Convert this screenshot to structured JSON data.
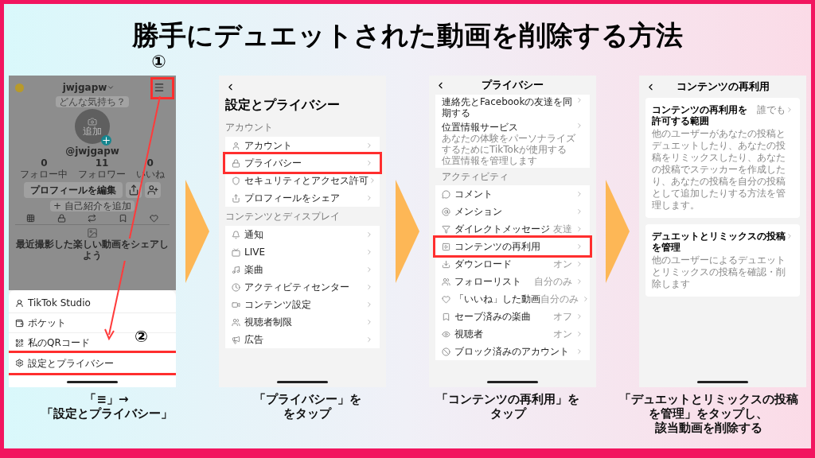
{
  "title": "勝手にデュエットされた動画を削除する方法",
  "screens": [
    {
      "kind": "profile",
      "username": "jwjgapw",
      "mood_bubble": "どんな気持ち？",
      "avatar_label": "追加",
      "handle": "@jwjgapw",
      "stats": [
        {
          "value": "0",
          "label": "フォロー中"
        },
        {
          "value": "11",
          "label": "フォロワー"
        },
        {
          "value": "0",
          "label": "いいね"
        }
      ],
      "edit_button": "プロフィールを編集",
      "bio_button": "+ 自己紹介を追加",
      "empty_message": "最近撮影した楽しい動画をシェアしよう",
      "menu": [
        {
          "label": "TikTok Studio",
          "highlighted": false
        },
        {
          "label": "ポケット",
          "highlighted": false
        },
        {
          "label": "私のQRコード",
          "highlighted": false
        },
        {
          "label": "設定とプライバシー",
          "highlighted": true
        }
      ],
      "markers": [
        "①",
        "②"
      ]
    },
    {
      "kind": "settings",
      "title": "設定とプライバシー",
      "sections": [
        {
          "heading": "アカウント",
          "items": [
            {
              "label": "アカウント",
              "highlighted": false
            },
            {
              "label": "プライバシー",
              "highlighted": true
            },
            {
              "label": "セキュリティとアクセス許可",
              "highlighted": false
            },
            {
              "label": "プロフィールをシェア",
              "highlighted": false
            }
          ]
        },
        {
          "heading": "コンテンツとディスプレイ",
          "items": [
            {
              "label": "通知",
              "highlighted": false
            },
            {
              "label": "LIVE",
              "highlighted": false
            },
            {
              "label": "楽曲",
              "highlighted": false
            },
            {
              "label": "アクティビティセンター",
              "highlighted": false
            },
            {
              "label": "コンテンツ設定",
              "highlighted": false
            },
            {
              "label": "視聴者制限",
              "highlighted": false
            },
            {
              "label": "広告",
              "highlighted": false
            }
          ]
        }
      ]
    },
    {
      "kind": "privacy",
      "title": "プライバシー",
      "top_items": [
        {
          "label": "連絡先とFacebookの友達を同期する"
        },
        {
          "label": "位置情報サービス",
          "description": "あなたの体験をパーソナライズするためにTikTokが使用する位置情報を管理します"
        }
      ],
      "sections": [
        {
          "heading": "アクティビティ",
          "items": [
            {
              "label": "コメント",
              "highlighted": false
            },
            {
              "label": "メンション",
              "highlighted": false
            },
            {
              "label": "ダイレクトメッセージ",
              "value": "友達",
              "highlighted": false
            },
            {
              "label": "コンテンツの再利用",
              "highlighted": true
            },
            {
              "label": "ダウンロード",
              "value": "オン",
              "highlighted": false
            },
            {
              "label": "フォローリスト",
              "value": "自分のみ",
              "highlighted": false
            },
            {
              "label": "「いいね」した動画",
              "value": "自分のみ",
              "highlighted": false
            },
            {
              "label": "セーブ済みの楽曲",
              "value": "オフ",
              "highlighted": false
            },
            {
              "label": "視聴者",
              "value": "オン",
              "highlighted": false
            },
            {
              "label": "ブロック済みのアカウント",
              "highlighted": false
            }
          ]
        }
      ]
    },
    {
      "kind": "reuse",
      "title": "コンテンツの再利用",
      "items": [
        {
          "label": "コンテンツの再利用を許可する範囲",
          "value": "誰でも",
          "description": "他のユーザーがあなたの投稿とデュエットしたり、あなたの投稿をリミックスしたり、あなたの投稿でステッカーを作成したり、あなたの投稿を自分の投稿として追加したりする方法を管理します。"
        },
        {
          "label": "デュエットとリミックスの投稿を管理",
          "description": "他のユーザーによるデュエットとリミックスの投稿を確認・削除します"
        }
      ]
    }
  ],
  "captions": [
    [
      "「≡」→",
      "「設定とプライバシー」"
    ],
    [
      "「プライバシー」を",
      "をタップ"
    ],
    [
      "「コンテンツの再利用」を",
      "タップ"
    ],
    [
      "「デュエットとリミックスの投稿",
      "を管理」をタップし、",
      "該当動画を削除する"
    ]
  ]
}
